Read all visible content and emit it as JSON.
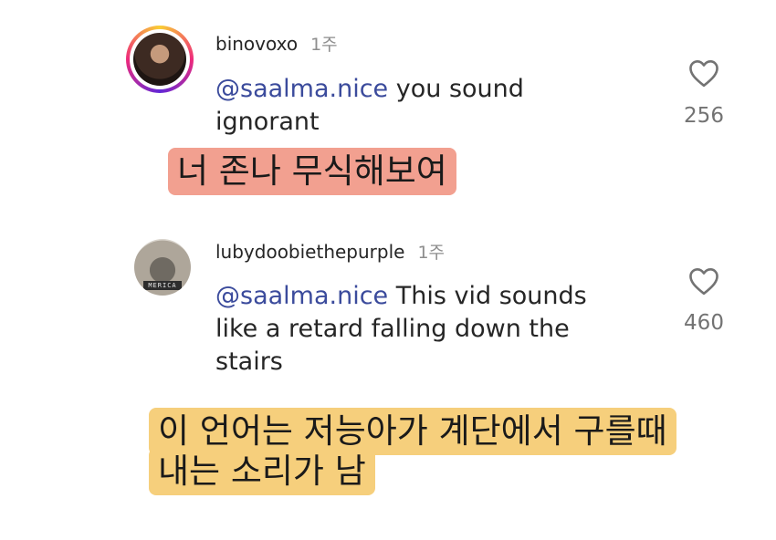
{
  "comments": [
    {
      "username": "binovoxo",
      "time": "1주",
      "mention": "@saalma.nice",
      "text_line1": " you sound",
      "text_line2": "ignorant",
      "likes": "256"
    },
    {
      "username": "lubydoobiethepurple",
      "time": "1주",
      "mention": "@saalma.nice",
      "text_line1": " This vid sounds",
      "text_line2": "like a retard falling down the",
      "text_line3": "stairs",
      "likes": "460",
      "avatar_label": "MERICA"
    }
  ],
  "translations": [
    {
      "line1": "너 존나 무식해보여"
    },
    {
      "line1": "이 언어는 저능아가 계단에서 구를때",
      "line2": "내는 소리가 남"
    }
  ],
  "colors": {
    "mention": "#3b4b9c",
    "translation_1_bg": "#f2a090",
    "translation_2_bg": "#f6cf7c",
    "muted": "#8e8e8e"
  },
  "icons": [
    "heart-icon",
    "heart-icon"
  ]
}
